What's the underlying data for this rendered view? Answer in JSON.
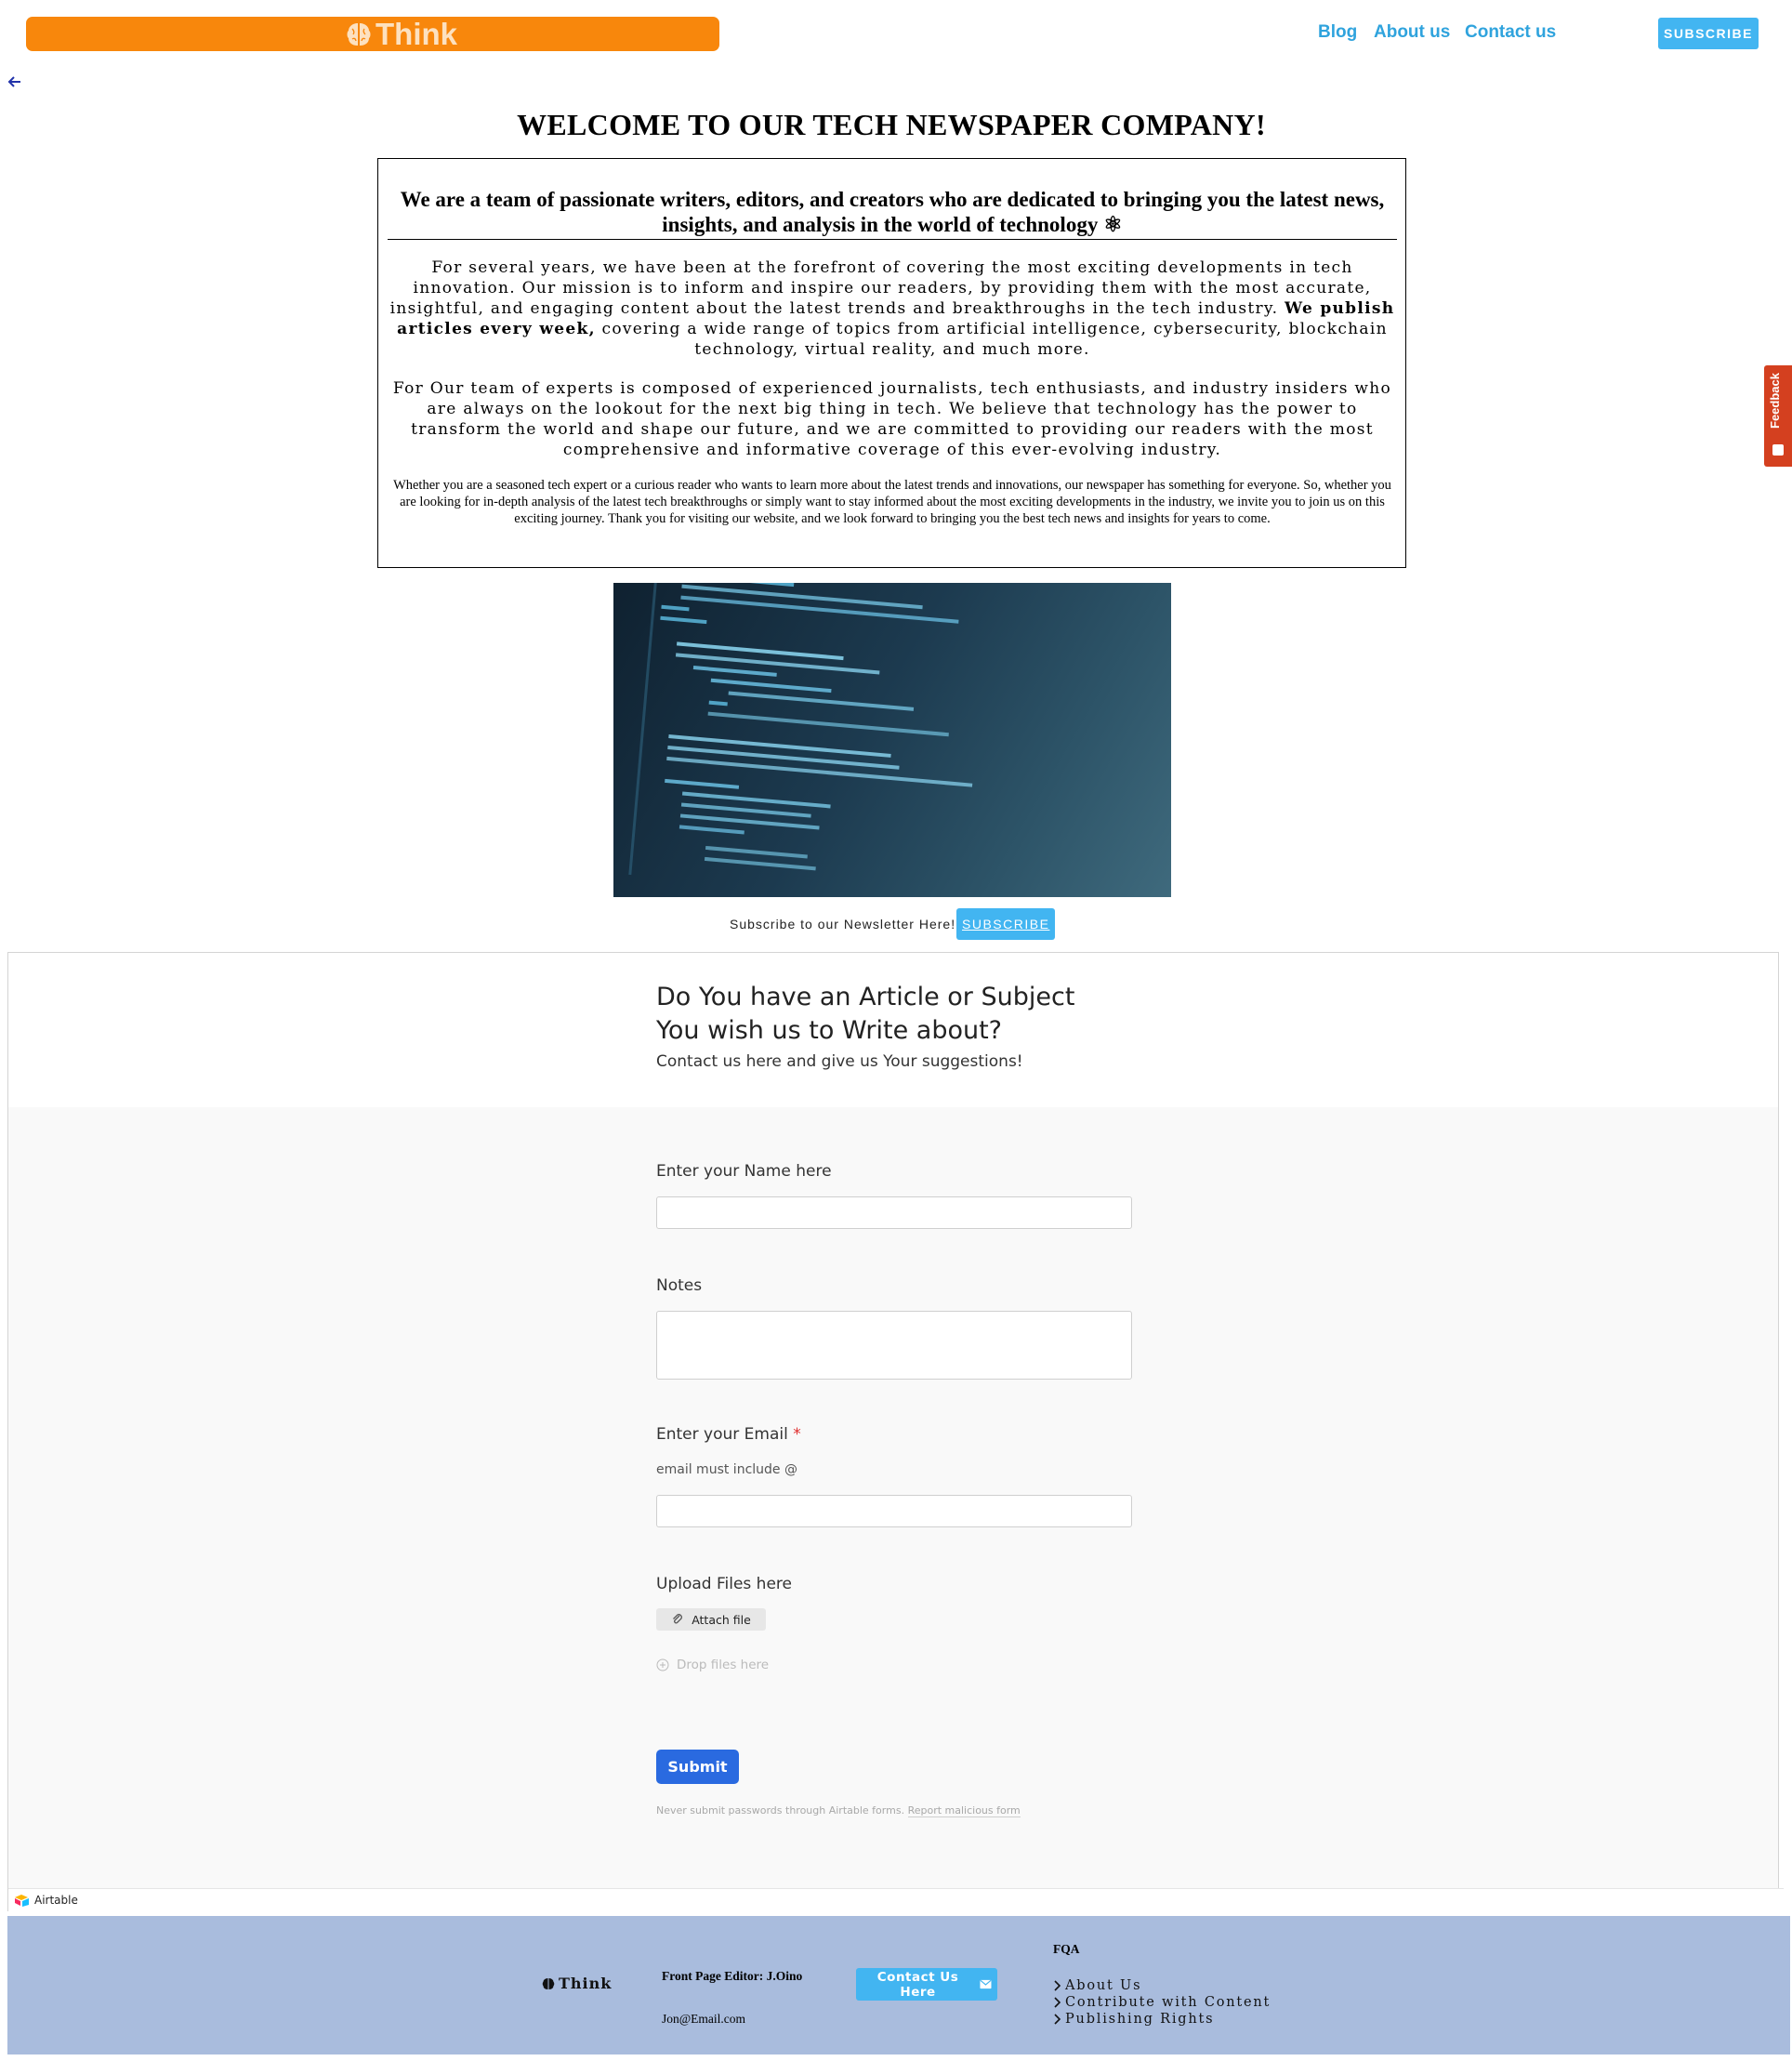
{
  "header": {
    "logo_text": "Think",
    "nav": [
      "Blog",
      "About us",
      "Contact us"
    ],
    "subscribe_label": "SUBSCRIBE"
  },
  "hero": {
    "title": "WELCOME TO OUR TECH NEWSPAPER COMPANY!",
    "box_heading": "We are a team of passionate writers, editors, and creators who are dedicated to bringing you the latest news, insights, and analysis in the world of technology",
    "box_heading_icon": "⚛",
    "p1_start": "For several years, we have been at the forefront of covering the most exciting developments in tech innovation. Our mission is to inform and inspire our readers, by providing them with the most accurate, insightful, and engaging content about the latest trends and breakthroughs in the tech industry. ",
    "p1_bold": "We publish articles every week,",
    "p1_end": " covering a wide range of topics from artificial intelligence, cybersecurity, blockchain technology, virtual reality, and much more.",
    "p2": "For Our team of experts is composed of experienced journalists, tech enthusiasts, and industry insiders who are always on the lookout for the next big thing in tech. We believe that technology has the power to transform the world and shape our future, and we are committed to providing our readers with the most comprehensive and informative coverage of this ever-evolving industry.",
    "p3": "Whether you are a seasoned tech expert or a curious reader who wants to learn more about the latest trends and innovations, our newspaper has something for everyone. So, whether you are looking for in-depth analysis of the latest tech breakthroughs or simply want to stay informed about the most exciting developments in the industry, we invite you to join us on this exciting journey. Thank you for visiting our website, and we look forward to bringing you the best tech news and insights for years to come."
  },
  "newsletter": {
    "text": "Subscribe to our Newsletter Here!",
    "button": "SUBSCRIBE"
  },
  "feedback_tab": "Feedback",
  "form": {
    "title": "Do You have an Article or Subject You wish us to Write about?",
    "subtitle": "Contact us here and give us Your suggestions!",
    "name_label": "Enter your Name here",
    "notes_label": "Notes",
    "email_label": "Enter your Email",
    "email_required": "*",
    "email_help": "email must include @",
    "upload_label": "Upload Files here",
    "attach_label": "Attach file",
    "drop_label": "Drop files here",
    "submit_label": "Submit",
    "disclaimer": "Never submit passwords through Airtable forms.",
    "report_link": "Report malicious form",
    "brand": "Airtable"
  },
  "footer": {
    "logo_text": "Think",
    "editor": "Front Page Editor: J.Oino",
    "email": "Jon@Email.com",
    "contact_button": "Contact Us Here",
    "fqa_title": "FQA",
    "links": [
      "About Us",
      "Contribute with Content",
      "Publishing Rights"
    ]
  },
  "colors": {
    "logo_bar": "#f8870c",
    "nav_link": "#2fa3dd",
    "subscribe": "#42b5f1",
    "submit": "#2a6ae0",
    "feedback": "#d4401f",
    "footer": "#a9bcdd"
  },
  "icons": [
    "brain-icon",
    "back-arrow-icon",
    "atom-icon",
    "paperclip-icon",
    "plus-circle-icon",
    "envelope-icon",
    "chevron-right-icon",
    "airtable-logo-icon",
    "feedback-icon"
  ]
}
